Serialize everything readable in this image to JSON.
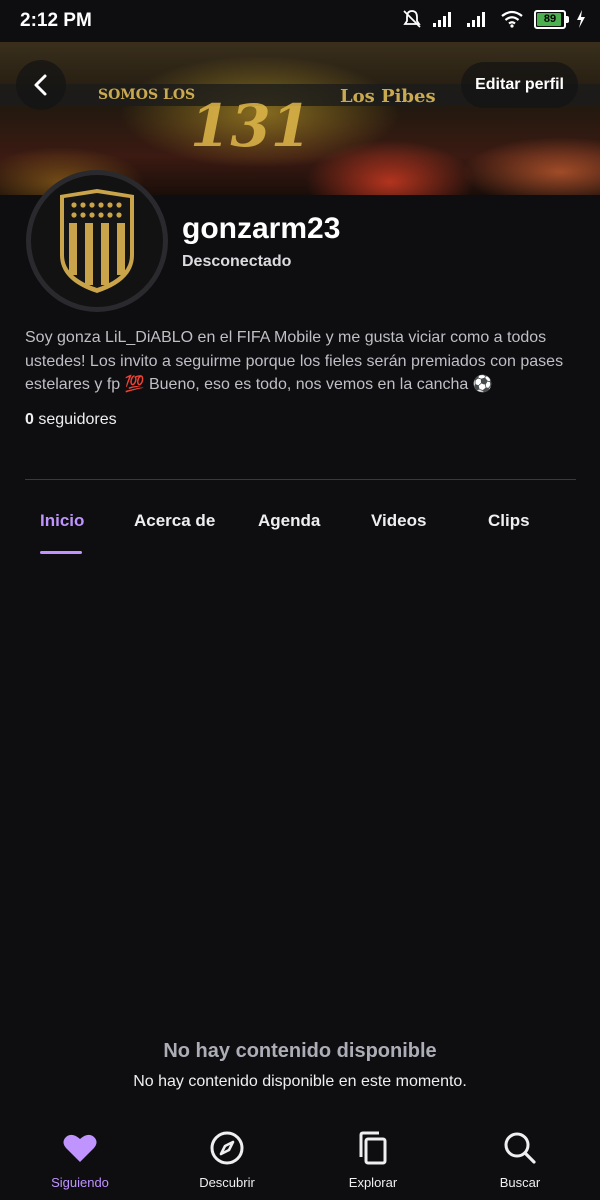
{
  "status_bar": {
    "time": "2:12 PM",
    "battery": "89"
  },
  "header": {
    "edit_profile_label": "Editar perfil",
    "banner_text_left": "SOMOS LOS",
    "banner_text_mid": "131",
    "banner_text_right": "Los Pibes"
  },
  "profile": {
    "username": "gonzarm23",
    "status": "Desconectado",
    "bio": "Soy gonza LiL_DiABLO en el FIFA Mobile y me gusta viciar como a todos ustedes! Los invito a seguirme porque los fieles serán premiados con pases estelares y fp 💯 Bueno, eso es todo, nos vemos en la cancha ⚽",
    "followers_count": "0",
    "followers_label": "seguidores"
  },
  "tabs": [
    {
      "label": "Inicio",
      "active": true
    },
    {
      "label": "Acerca de"
    },
    {
      "label": "Agenda"
    },
    {
      "label": "Videos"
    },
    {
      "label": "Clips"
    }
  ],
  "empty_state": {
    "title": "No hay contenido disponible",
    "subtitle": "No hay contenido disponible en este momento."
  },
  "bottom_nav": [
    {
      "label": "Siguiendo",
      "icon": "heart-icon",
      "active": true
    },
    {
      "label": "Descubrir",
      "icon": "compass-icon"
    },
    {
      "label": "Explorar",
      "icon": "browse-icon"
    },
    {
      "label": "Buscar",
      "icon": "search-icon"
    }
  ],
  "colors": {
    "accent": "#bf94ff",
    "background": "#0e0e10",
    "crest_gold": "#c9a44a"
  }
}
